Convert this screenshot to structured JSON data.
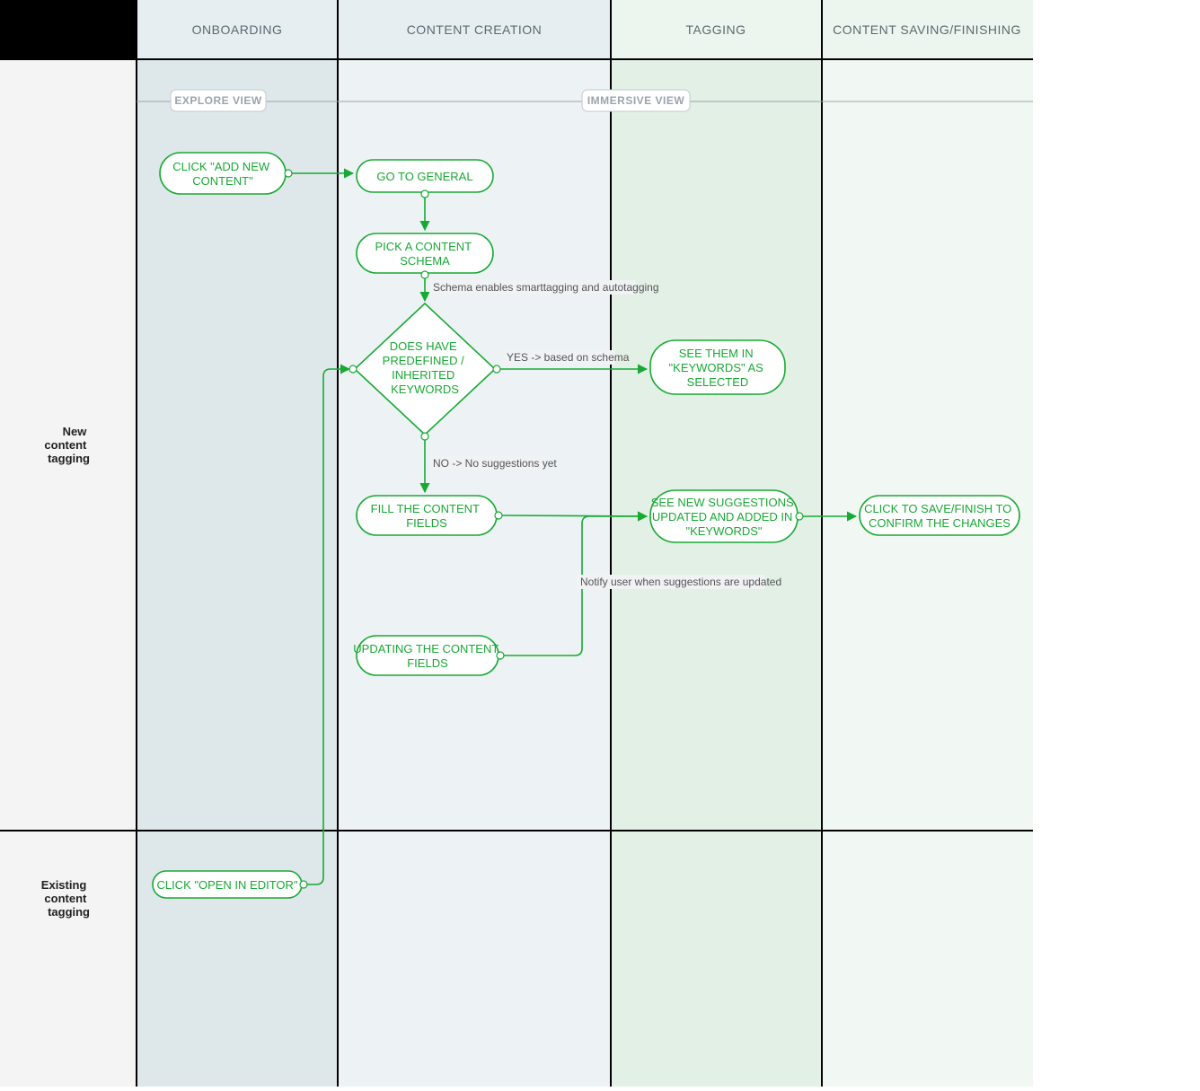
{
  "columns": {
    "onboarding": "ONBOARDING",
    "content_creation": "CONTENT CREATION",
    "tagging": "TAGGING",
    "content_saving": "CONTENT SAVING/FINISHING"
  },
  "rows": {
    "new_tagging_l1": "New",
    "new_tagging_l2": "content",
    "new_tagging_l3": "tagging",
    "existing_tagging_l1": "Existing",
    "existing_tagging_l2": "content",
    "existing_tagging_l3": "tagging"
  },
  "views": {
    "explore": "EXPLORE VIEW",
    "immersive": "IMMERSIVE VIEW"
  },
  "nodes": {
    "add_new_l1": "CLICK \"ADD NEW",
    "add_new_l2": "CONTENT\"",
    "go_general": "GO TO GENERAL",
    "pick_schema_l1": "PICK A CONTENT",
    "pick_schema_l2": "SCHEMA",
    "decision_l1": "DOES HAVE",
    "decision_l2": "PREDEFINED /",
    "decision_l3": "INHERITED",
    "decision_l4": "KEYWORDS",
    "see_selected_l1": "SEE THEM IN",
    "see_selected_l2": "\"KEYWORDS\" AS",
    "see_selected_l3": "SELECTED",
    "fill_fields_l1": "FILL THE CONTENT",
    "fill_fields_l2": "FIELDS",
    "see_suggest_l1": "SEE NEW SUGGESTIONS",
    "see_suggest_l2": "UPDATED AND ADDED IN",
    "see_suggest_l3": "\"KEYWORDS\"",
    "save_finish_l1": "CLICK TO SAVE/FINISH TO",
    "save_finish_l2": "CONFIRM THE CHANGES",
    "update_fields_l1": "UPDATING THE CONTENT",
    "update_fields_l2": "FIELDS",
    "open_editor": "CLICK \"OPEN IN EDITOR\""
  },
  "edge_labels": {
    "schema_enables": "Schema enables smarttagging and autotagging",
    "yes_branch": "YES -> based on schema",
    "no_branch": "NO -> No suggestions yet",
    "notify_update": "Notify user when suggestions are updated"
  }
}
